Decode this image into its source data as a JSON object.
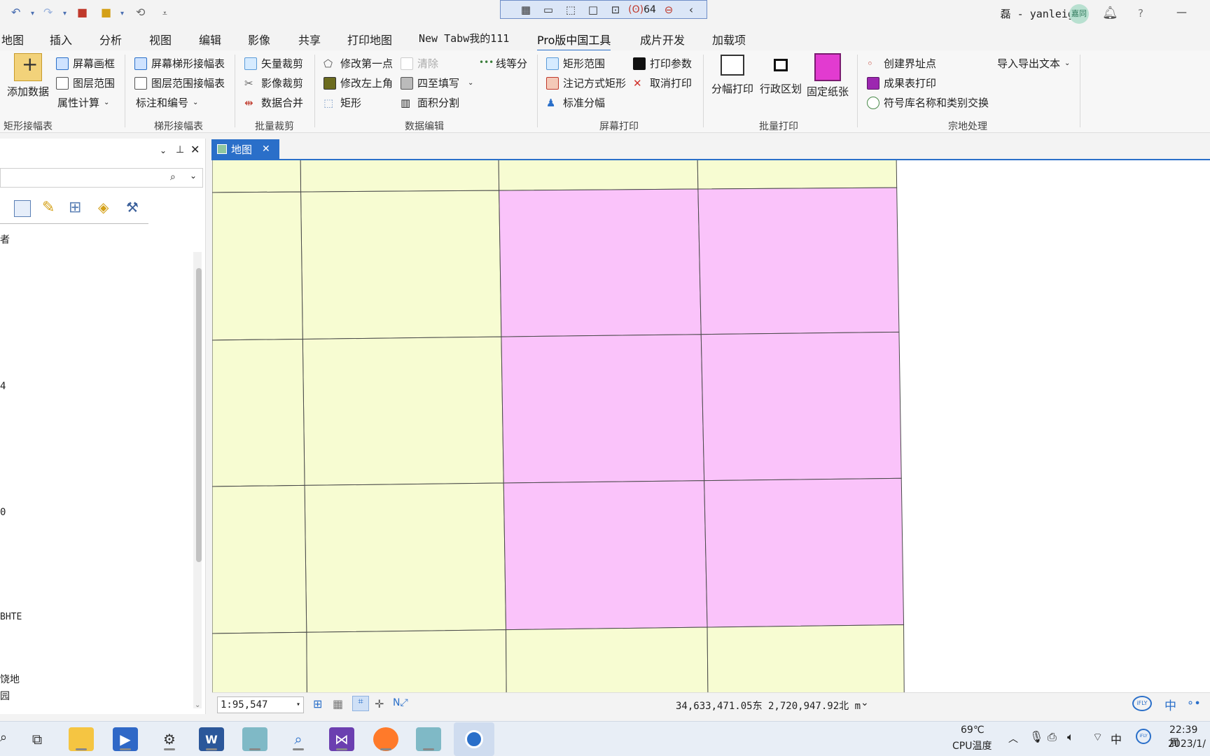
{
  "titlebar": {
    "capture_count": "64",
    "user": "磊 - yanleigis",
    "avatar": "嘉同",
    "help": "?",
    "minimize": "—"
  },
  "menu_tabs": [
    "地图",
    "插入",
    "分析",
    "视图",
    "编辑",
    "影像",
    "共享",
    "打印地图",
    "New Tabw我的111",
    "Pro版中国工具",
    "成片开发",
    "加载项"
  ],
  "active_tab": "Pro版中国工具",
  "ribbon": {
    "add_data": "添加数据",
    "screen_frame": "屏幕画框",
    "layer_extent": "图层范围",
    "attr_calc": "属性计算",
    "group_rect": "矩形接幅表",
    "screen_trapezoid": "屏幕梯形接幅表",
    "layer_extent_join": "图层范围接幅表",
    "label_number": "标注和编号",
    "group_trapezoid": "梯形接幅表",
    "vector_clip": "矢量裁剪",
    "image_clip": "影像裁剪",
    "data_merge": "数据合并",
    "group_batch_clip": "批量裁剪",
    "modify_first_point": "修改第一点",
    "modify_top_left": "修改左上角",
    "rectangle": "矩形",
    "clear": "清除",
    "four_fill": "四至填写",
    "area_split": "面积分割",
    "line_equal": "线等分",
    "group_data_edit": "数据编辑",
    "rect_range": "矩形范围",
    "label_rect": "注记方式矩形",
    "std_sheet": "标准分幅",
    "print_params": "打印参数",
    "cancel_print": "取消打印",
    "group_screen_print": "屏幕打印",
    "sheet_print": "分幅打印",
    "admin_division": "行政区划",
    "fixed_paper": "固定纸张",
    "group_batch_print": "批量打印",
    "create_boundary_point": "创建界址点",
    "result_table_print": "成果表打印",
    "symbol_swap": "符号库名称和类别交换",
    "import_export_text": "导入导出文本",
    "group_parcel": "宗地处理"
  },
  "left_panel": {
    "rows": [
      "者",
      "4",
      "0",
      "BHTE",
      "饶地",
      "园"
    ]
  },
  "map_tab": {
    "label": "地图"
  },
  "map_colors": {
    "yellow": "#f7fcd2",
    "pink": "#fac3fa",
    "line": "#4a4a4a"
  },
  "status": {
    "scale": "1:95,547",
    "coords": "34,633,471.05东  2,720,947.92北 m"
  },
  "tray": {
    "temp": "69℃",
    "temp_label": "CPU温度",
    "ime": "中",
    "time": "22:39 周",
    "date": "2023/1/"
  }
}
